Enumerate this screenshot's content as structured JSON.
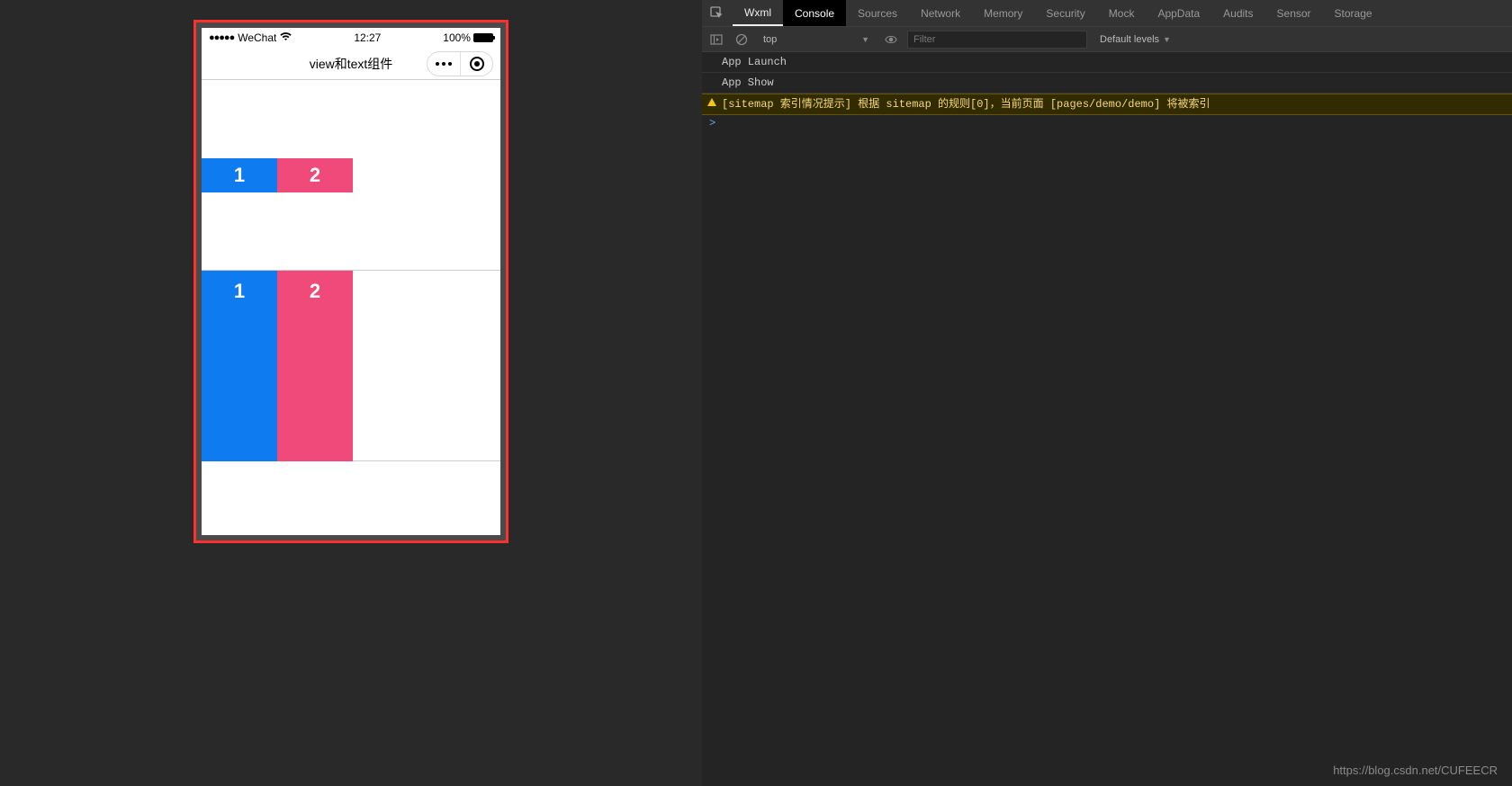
{
  "simulator": {
    "status": {
      "signal_dots": "●●●●●",
      "carrier": "WeChat",
      "wifi_icon": "wifi-icon",
      "time": "12:27",
      "battery_pct": "100%"
    },
    "nav": {
      "title": "view和text组件",
      "menu_icon": "ellipsis-icon",
      "close_icon": "target-icon"
    },
    "sections": {
      "a": {
        "box1": "1",
        "box2": "2"
      },
      "b": {
        "box1": "1",
        "box2": "2"
      }
    }
  },
  "devtools": {
    "tabs": [
      "Wxml",
      "Console",
      "Sources",
      "Network",
      "Memory",
      "Security",
      "Mock",
      "AppData",
      "Audits",
      "Sensor",
      "Storage"
    ],
    "tab_active_underline": "Wxml",
    "tab_active_bg": "Console",
    "toolbar": {
      "context": "top",
      "filter_placeholder": "Filter",
      "levels": "Default levels"
    },
    "logs": [
      {
        "type": "info",
        "text": "App Launch"
      },
      {
        "type": "info",
        "text": "App Show"
      },
      {
        "type": "warn",
        "prefix": "[sitemap 索引情况提示]",
        "mid": " 根据 sitemap 的规则[0]，当前页面 ",
        "path": "[pages/demo/demo]",
        "suffix": " 将被索引"
      }
    ],
    "prompt": ">"
  },
  "watermark": "https://blog.csdn.net/CUFEECR",
  "colors": {
    "blue": "#0e7bf0",
    "pink": "#ef4a79",
    "highlight_border": "#ff3030"
  }
}
